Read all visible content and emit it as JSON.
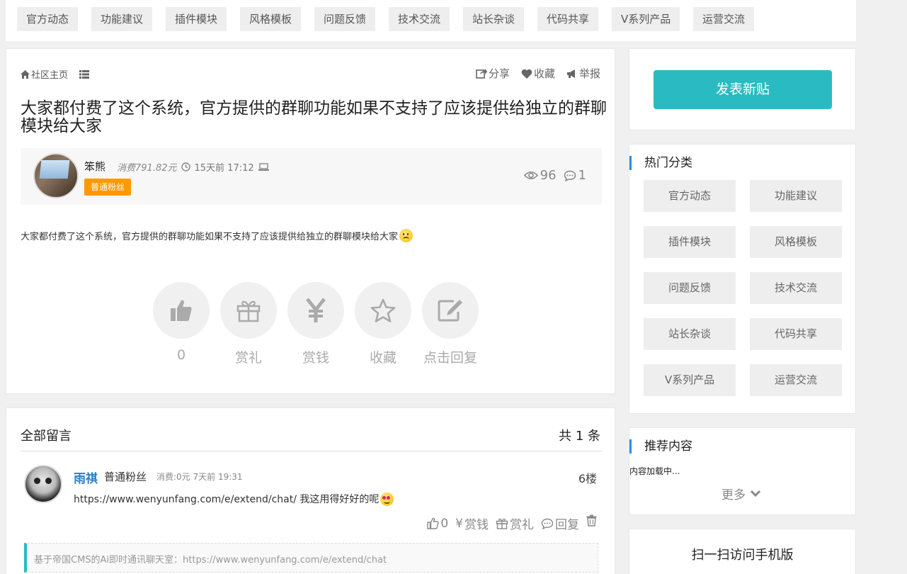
{
  "top_nav": [
    "官方动态",
    "功能建议",
    "插件模块",
    "风格模板",
    "问题反馈",
    "技术交流",
    "站长杂谈",
    "代码共享",
    "V系列产品",
    "运营交流"
  ],
  "post": {
    "breadcrumb_home": "社区主页",
    "actions": {
      "share": "分享",
      "favorite": "收藏",
      "report": "举报"
    },
    "title": "大家都付费了这个系统，官方提供的群聊功能如果不支持了应该提供给独立的群聊模块给大家",
    "author": {
      "name": "笨熊",
      "spent": "消费791.82元",
      "time": "15天前 17:12",
      "badge": "普通粉丝",
      "views": "96",
      "replies": "1"
    },
    "body": "大家都付费了这个系统，官方提供的群聊功能如果不支持了应该提供给独立的群聊模块给大家",
    "reactions": {
      "like_count": "0",
      "gift": "赏礼",
      "money": "赏钱",
      "favorite": "收藏",
      "reply": "点击回复"
    }
  },
  "comments": {
    "header": "全部留言",
    "count": "共 1 条",
    "items": [
      {
        "name": "雨祺",
        "rank": "普通粉丝",
        "meta": "消费:0元 7天前 19:31",
        "floor": "6楼",
        "text": "https://www.wenyunfang.com/e/extend/chat/ 我这用得好好的呢",
        "actions": {
          "like": "0",
          "money": "赏钱",
          "gift": "赏礼",
          "reply": "回复"
        },
        "quote": "基于帝国CMS的Ai即时通讯聊天室：https://www.wenyunfang.com/e/extend/chat"
      }
    ]
  },
  "sidebar": {
    "new_post": "发表新贴",
    "hot_title": "热门分类",
    "categories": [
      "官方动态",
      "功能建议",
      "插件模块",
      "风格模板",
      "问题反馈",
      "技术交流",
      "站长杂谈",
      "代码共享",
      "V系列产品",
      "运营交流"
    ],
    "recommend_title": "推荐内容",
    "recommend_loading": "内容加载中...",
    "more": "更多",
    "mobile_title": "扫一扫访问手机版"
  },
  "colors": {
    "accent": "#29bbc1",
    "badge": "#ff9900",
    "link": "#2b7fc7",
    "section_bar": "#2b8fd8"
  }
}
